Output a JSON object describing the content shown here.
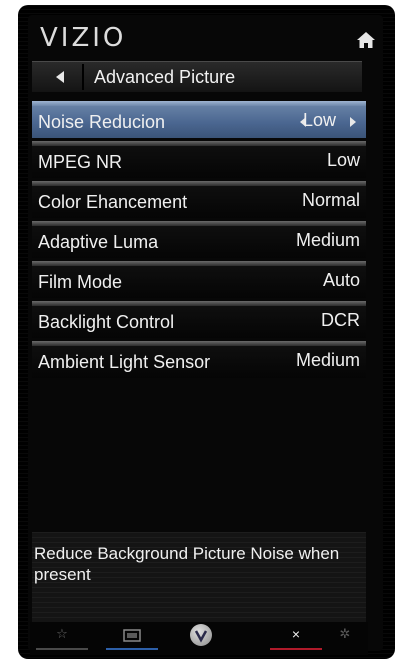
{
  "brand": "VIZIO",
  "icons": {
    "home": "home-icon",
    "back": "back-arrow-icon",
    "favorites": "star-icon",
    "input": "input-icon",
    "vizio": "vizio-v-icon",
    "exit": "close-icon",
    "settings": "gear-icon"
  },
  "submenu": {
    "title": "Advanced Picture"
  },
  "settings": [
    {
      "label": "Noise Reducion",
      "value": "Low",
      "selected": true
    },
    {
      "label": "MPEG NR",
      "value": "Low"
    },
    {
      "label": "Color Ehancement",
      "value": "Normal"
    },
    {
      "label": "Adaptive Luma",
      "value": "Medium"
    },
    {
      "label": "Film Mode",
      "value": "Auto"
    },
    {
      "label": "Backlight Control",
      "value": "DCR"
    },
    {
      "label": "Ambient Light Sensor",
      "value": "Medium"
    }
  ],
  "help": {
    "text": "Reduce Background Picture Noise when present"
  },
  "bottom_bar": {
    "exit_glyph": "×",
    "star_glyph": "☆",
    "gear_glyph": "✲"
  },
  "colors": {
    "selected_row": "#4a6690",
    "input_underline": "#2d5fa8",
    "exit_underline": "#b01a2a"
  }
}
